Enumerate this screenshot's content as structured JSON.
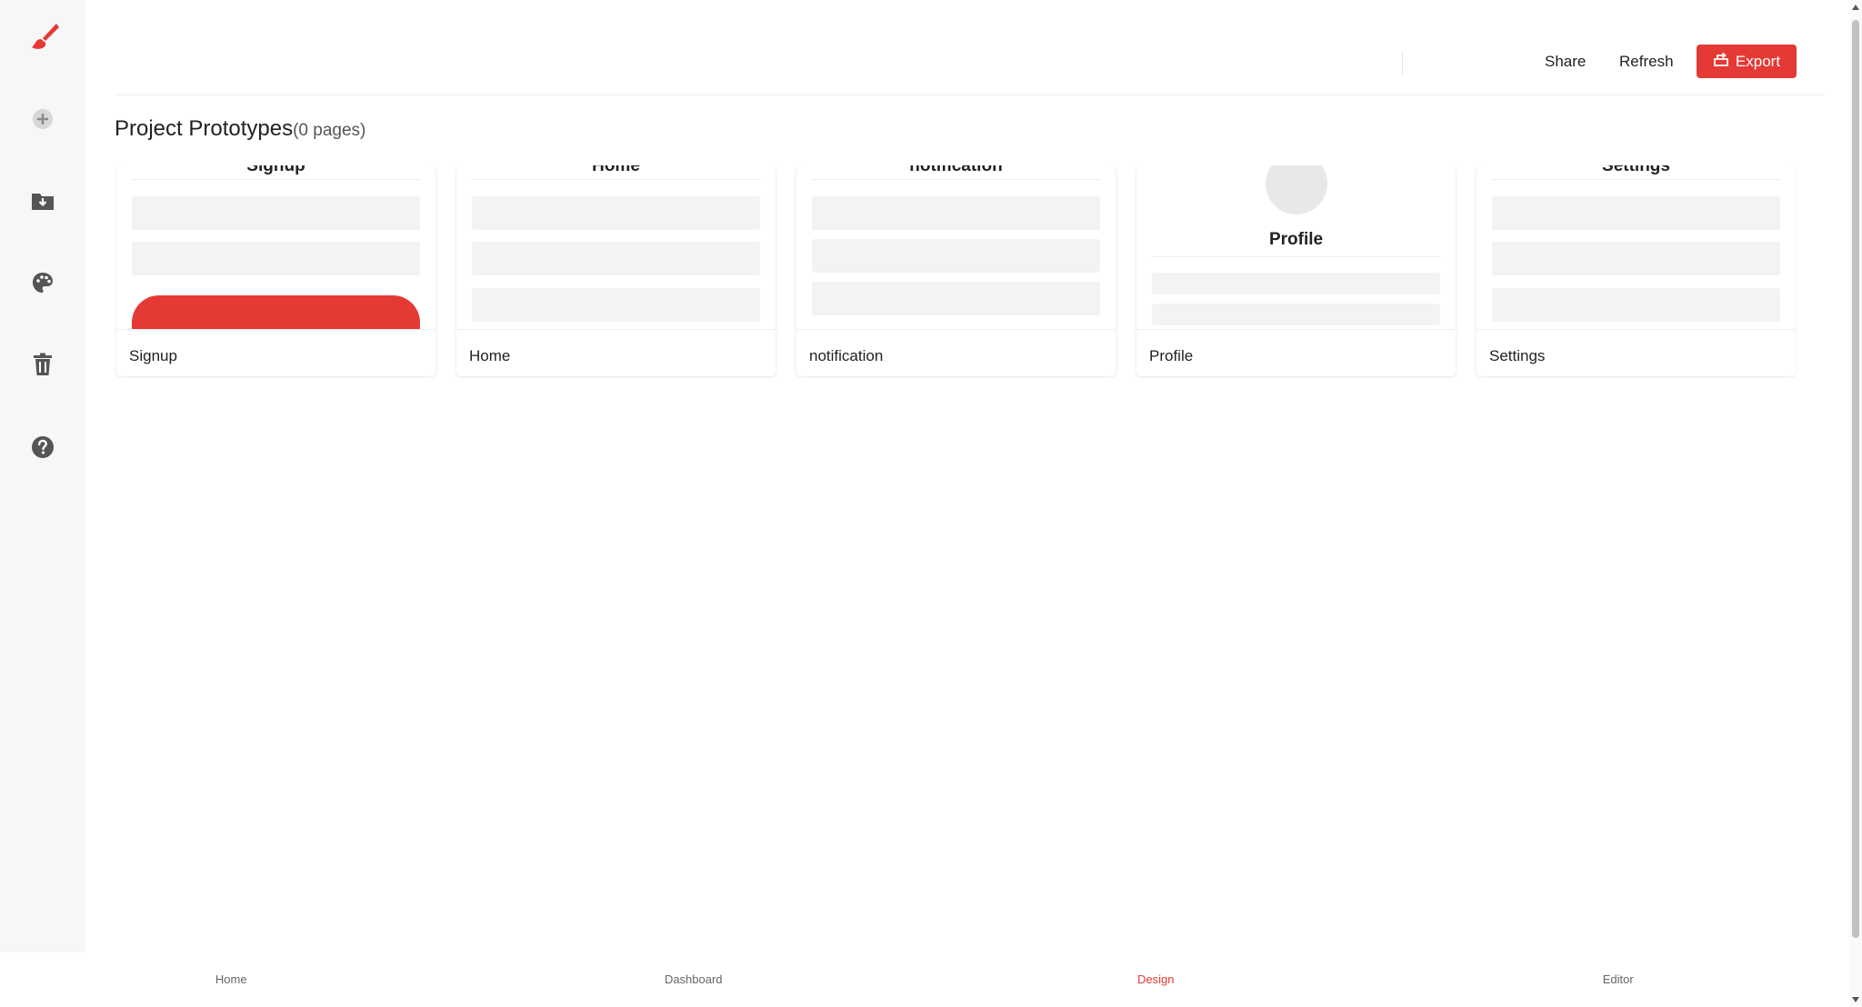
{
  "colors": {
    "accent": "#e53935",
    "sidebar_bg": "#f7f7f7",
    "placeholder": "#f3f3f3"
  },
  "sidebar": {
    "items": [
      {
        "icon": "brush-icon"
      },
      {
        "icon": "plus-circle-icon"
      },
      {
        "icon": "folder-download-icon"
      },
      {
        "icon": "palette-icon"
      },
      {
        "icon": "trash-icon"
      },
      {
        "icon": "help-icon"
      }
    ]
  },
  "header": {
    "share_label": "Share",
    "refresh_label": "Refresh",
    "export_label": "Export"
  },
  "page": {
    "title": "Project Prototypes",
    "count": "(0 pages)"
  },
  "cards": [
    {
      "preview_title": "Signup",
      "label": "Signup"
    },
    {
      "preview_title": "Home",
      "label": "Home"
    },
    {
      "preview_title": "notification",
      "label": "notification"
    },
    {
      "preview_title": "Profile",
      "label": "Profile"
    },
    {
      "preview_title": "Settings",
      "label": "Settings"
    }
  ],
  "bottom_nav": {
    "items": [
      {
        "label": "Home"
      },
      {
        "label": "Dashboard"
      },
      {
        "label": "Design",
        "active": true
      },
      {
        "label": "Editor"
      }
    ]
  }
}
